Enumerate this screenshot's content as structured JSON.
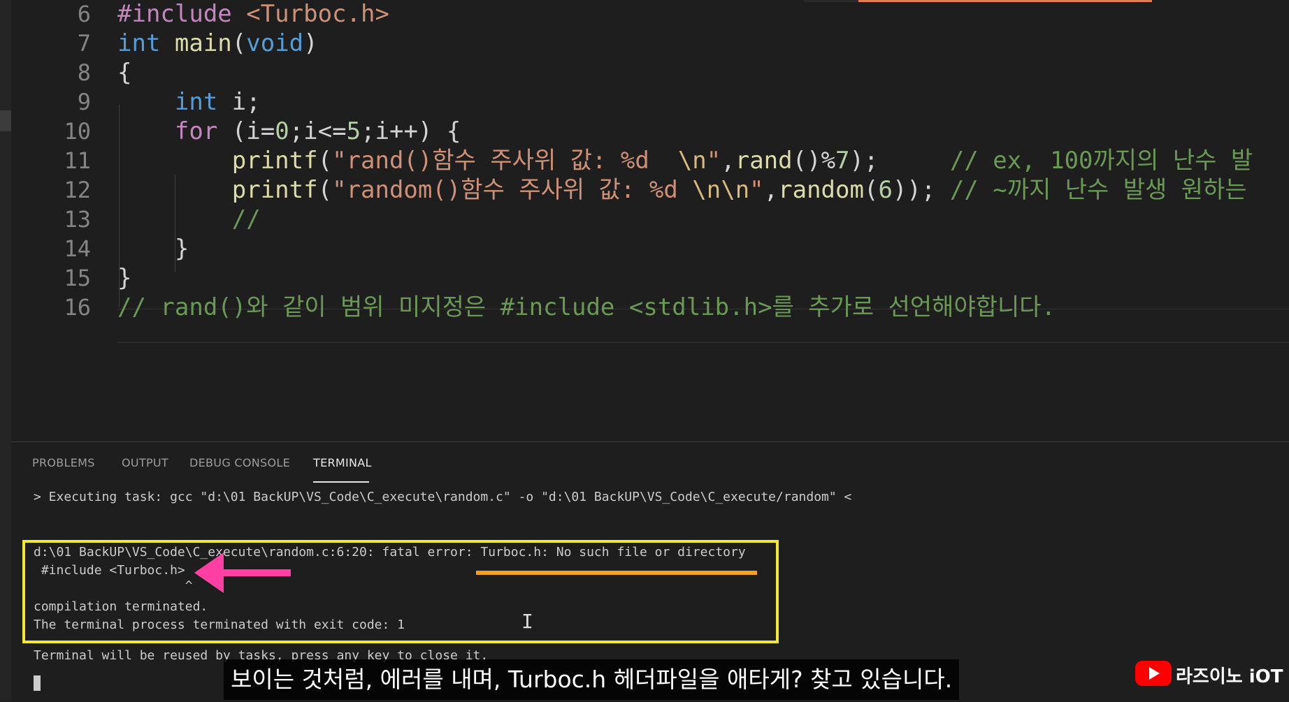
{
  "editor": {
    "lines": [
      {
        "n": "6",
        "segs": [
          {
            "c": "pp",
            "t": "#include "
          },
          {
            "c": "str",
            "t": "<Turboc.h>"
          }
        ]
      },
      {
        "n": "7",
        "segs": [
          {
            "c": "kw",
            "t": "int "
          },
          {
            "c": "fn",
            "t": "main"
          },
          {
            "c": "pl",
            "t": "("
          },
          {
            "c": "kw",
            "t": "void"
          },
          {
            "c": "pl",
            "t": ")"
          }
        ]
      },
      {
        "n": "8",
        "segs": [
          {
            "c": "pl",
            "t": "{"
          }
        ]
      },
      {
        "n": "9",
        "segs": [
          {
            "c": "pl",
            "t": "    "
          },
          {
            "c": "kw",
            "t": "int "
          },
          {
            "c": "pl",
            "t": "i;"
          }
        ]
      },
      {
        "n": "10",
        "segs": [
          {
            "c": "pl",
            "t": "    "
          },
          {
            "c": "pp",
            "t": "for "
          },
          {
            "c": "pl",
            "t": "(i="
          },
          {
            "c": "num",
            "t": "0"
          },
          {
            "c": "pl",
            "t": ";i<="
          },
          {
            "c": "num",
            "t": "5"
          },
          {
            "c": "pl",
            "t": ";i++) {"
          }
        ]
      },
      {
        "n": "11",
        "segs": [
          {
            "c": "pl",
            "t": "        "
          },
          {
            "c": "fn",
            "t": "printf"
          },
          {
            "c": "pl",
            "t": "("
          },
          {
            "c": "str",
            "t": "\"rand()함수 주사위 값: %d  "
          },
          {
            "c": "esc",
            "t": "\\n"
          },
          {
            "c": "str",
            "t": "\""
          },
          {
            "c": "pl",
            "t": ","
          },
          {
            "c": "fn",
            "t": "rand"
          },
          {
            "c": "pl",
            "t": "()%"
          },
          {
            "c": "num",
            "t": "7"
          },
          {
            "c": "pl",
            "t": ");     "
          },
          {
            "c": "cm",
            "t": "// ex, 100까지의 난수 발"
          }
        ]
      },
      {
        "n": "12",
        "segs": [
          {
            "c": "pl",
            "t": "        "
          },
          {
            "c": "fn",
            "t": "printf"
          },
          {
            "c": "pl",
            "t": "("
          },
          {
            "c": "str",
            "t": "\"random()함수 주사위 값: %d "
          },
          {
            "c": "esc",
            "t": "\\n\\n"
          },
          {
            "c": "str",
            "t": "\""
          },
          {
            "c": "pl",
            "t": ","
          },
          {
            "c": "fn",
            "t": "random"
          },
          {
            "c": "pl",
            "t": "("
          },
          {
            "c": "num",
            "t": "6"
          },
          {
            "c": "pl",
            "t": ")); "
          },
          {
            "c": "cm",
            "t": "// ~까지 난수 발생 원하는"
          }
        ]
      },
      {
        "n": "13",
        "segs": [
          {
            "c": "pl",
            "t": "        "
          },
          {
            "c": "cm",
            "t": "//"
          }
        ]
      },
      {
        "n": "14",
        "segs": [
          {
            "c": "pl",
            "t": "    }"
          }
        ]
      },
      {
        "n": "15",
        "segs": [
          {
            "c": "pl",
            "t": "}"
          }
        ]
      },
      {
        "n": "16",
        "segs": [
          {
            "c": "cm",
            "t": "// rand()와 같이 범위 미지정은 #include <stdlib.h>를 추가로 선언해야합니다."
          }
        ]
      }
    ]
  },
  "panel": {
    "tabs": {
      "problems": "PROBLEMS",
      "output": "OUTPUT",
      "debug_console": "DEBUG CONSOLE",
      "terminal": "TERMINAL"
    },
    "terminal": {
      "exec_line": "> Executing task: gcc \"d:\\01 BackUP\\VS_Code\\C_execute\\random.c\" -o \"d:\\01 BackUP\\VS_Code\\C_execute/random\" <",
      "error_line": "d:\\01 BackUP\\VS_Code\\C_execute\\random.c:6:20: fatal error: Turboc.h: No such file or directory",
      "include_line": " #include <Turboc.h>",
      "caret_line": "                    ^",
      "compilation_line": "compilation terminated.",
      "exit_line": "The terminal process terminated with exit code: 1",
      "reuse_line": "Terminal will be reused by tasks, press any key to close it."
    }
  },
  "overlay": {
    "subtitle": "보이는 것처럼, 에러를 내며, Turboc.h 헤더파일을 애타게? 찾고 있습니다.",
    "channel_name": "라즈이노 iOT"
  },
  "colors": {
    "error_box": "#f5e830",
    "underline": "#f7a020",
    "arrow": "#ff3fa4"
  }
}
